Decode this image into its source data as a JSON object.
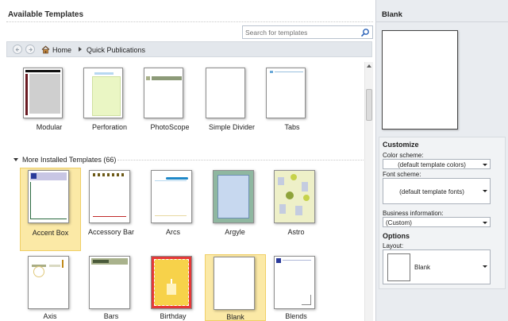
{
  "header": {
    "title": "Available Templates"
  },
  "search": {
    "placeholder": "Search for templates"
  },
  "breadcrumb": {
    "home": "Home",
    "current": "Quick Publications"
  },
  "quick_templates": [
    {
      "label": "Modular"
    },
    {
      "label": "Perforation"
    },
    {
      "label": "PhotoScope"
    },
    {
      "label": "Simple Divider"
    },
    {
      "label": "Tabs"
    }
  ],
  "installed_section": {
    "label": "More Installed Templates (66)"
  },
  "installed_templates": [
    {
      "label": "Accent Box",
      "selected": true
    },
    {
      "label": "Accessory Bar"
    },
    {
      "label": "Arcs"
    },
    {
      "label": "Argyle"
    },
    {
      "label": "Astro"
    },
    {
      "label": "Axis"
    },
    {
      "label": "Bars"
    },
    {
      "label": "Birthday"
    },
    {
      "label": "Blank",
      "selected": true
    },
    {
      "label": "Blends"
    }
  ],
  "right_panel": {
    "title": "Blank",
    "customize_title": "Customize",
    "color_scheme_label": "Color scheme:",
    "color_scheme_value": "(default template colors)",
    "font_scheme_label": "Font scheme:",
    "font_scheme_value": "(default template fonts)",
    "business_label": "Business information:",
    "business_value": "(Custom)",
    "options_title": "Options",
    "layout_label": "Layout:",
    "layout_value": "Blank"
  },
  "colors": {
    "selection_fill": "#fbe9a6",
    "selection_border": "#f0cf66",
    "panel_bg": "#e9ecf0",
    "navbar_bg": "#e3e7ec",
    "accent_blue": "#2a62b8"
  }
}
